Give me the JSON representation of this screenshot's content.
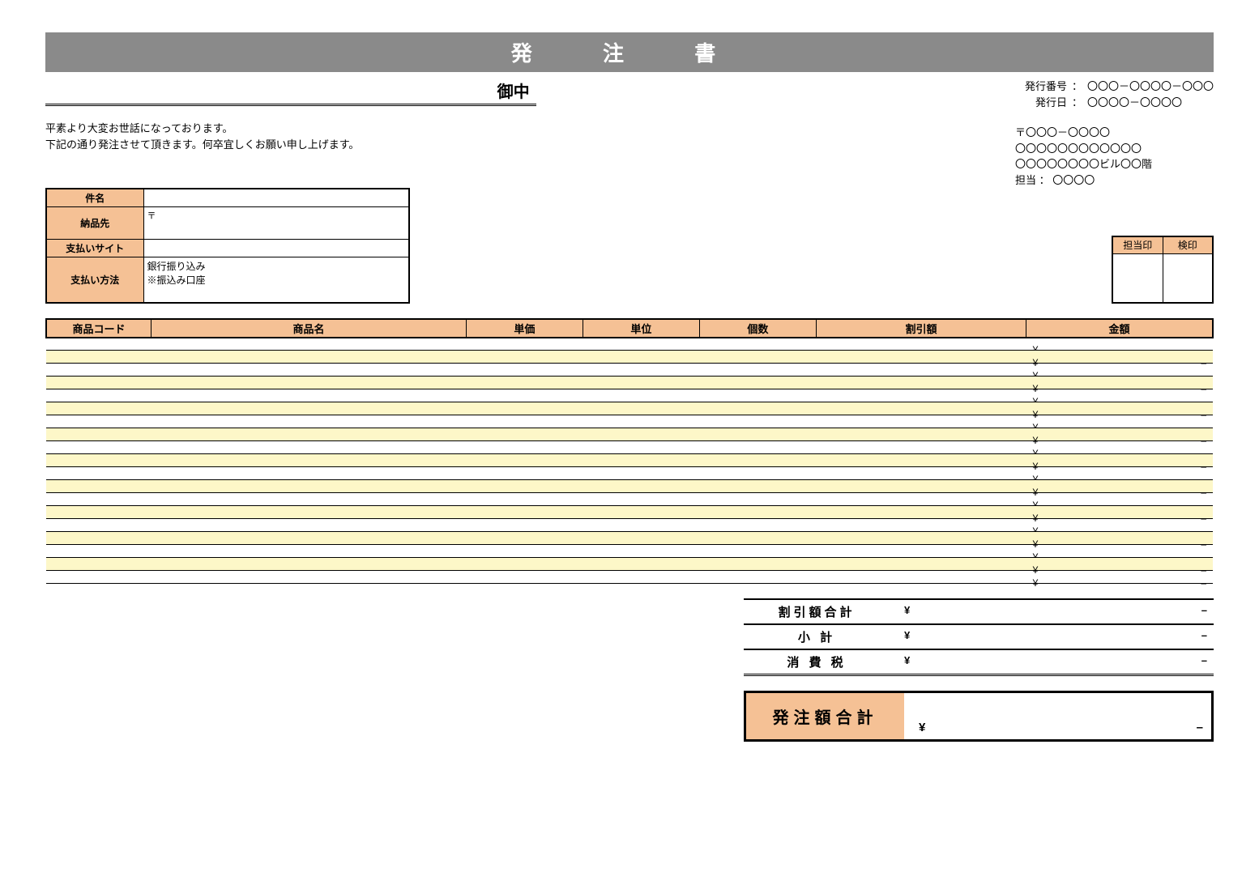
{
  "title": "発 注 書",
  "recipient_suffix": "御中",
  "greeting_line1": "平素より大変お世話になっております。",
  "greeting_line2": "下記の通り発注させて頂きます。何卒宜しくお願い申し上げます。",
  "issue": {
    "number_label": "発行番号",
    "number_value": "〇〇〇－〇〇〇〇－〇〇〇",
    "date_label": "発行日",
    "date_value": "〇〇〇〇－〇〇〇〇",
    "colon": "："
  },
  "sender": {
    "postal": "〒〇〇〇－〇〇〇〇",
    "line2": "〇〇〇〇〇〇〇〇〇〇〇〇",
    "line3": "〇〇〇〇〇〇〇〇ビル〇〇階",
    "contact_label": "担当 ：",
    "contact_name": "〇〇〇〇"
  },
  "info": {
    "subject_label": "件名",
    "subject_value": "",
    "delivery_label": "納品先",
    "delivery_postal_mark": "〒",
    "delivery_value": "",
    "payment_site_label": "支払いサイト",
    "payment_site_value": "",
    "payment_method_label": "支払い方法",
    "payment_method_line1": "銀行振り込み",
    "payment_method_line2": "※振込み口座"
  },
  "stamps": {
    "seal1": "担当印",
    "seal2": "検印"
  },
  "items_header": {
    "code": "商品コード",
    "name": "商品名",
    "unit_price": "単価",
    "unit": "単位",
    "qty": "個数",
    "discount": "割引額",
    "amount": "金額"
  },
  "yen_symbol": "¥",
  "dash_symbol": "–",
  "row_count": 19,
  "summary": {
    "discount_total": "割引額合計",
    "subtotal": "小 計",
    "tax": "消 費 税",
    "grand_total": "発注額合計"
  }
}
